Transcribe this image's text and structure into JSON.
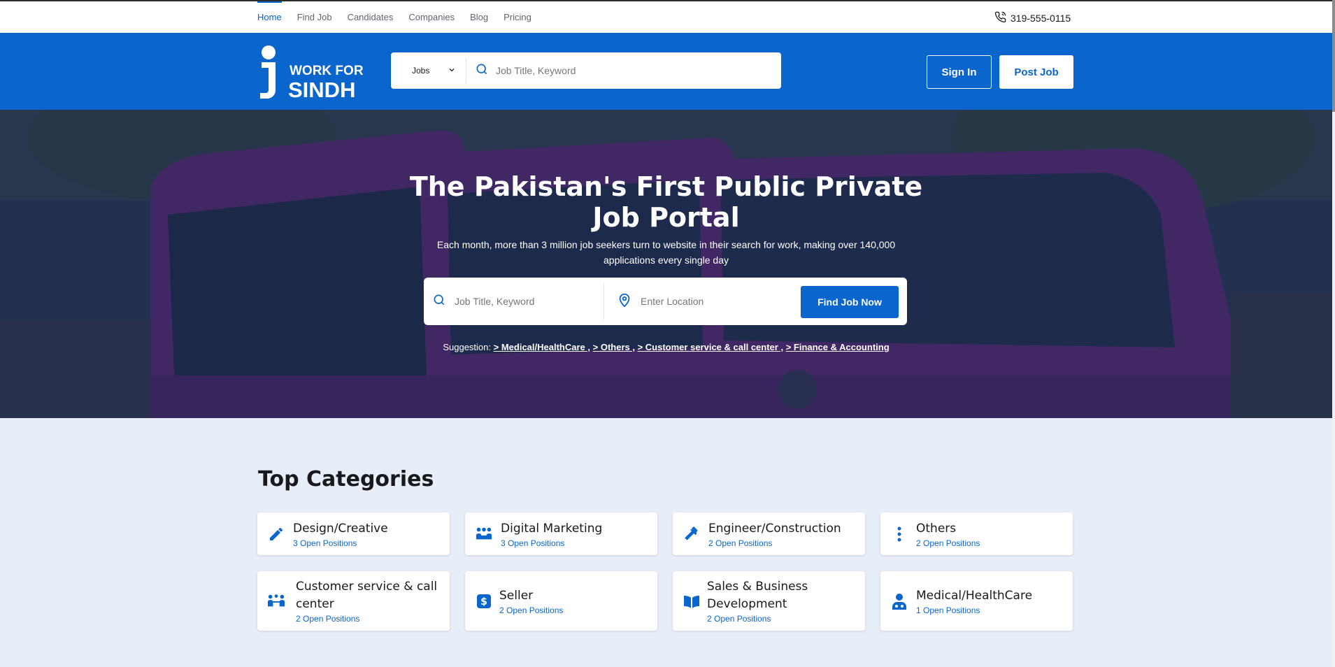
{
  "topnav": {
    "links": [
      "Home",
      "Find Job",
      "Candidates",
      "Companies",
      "Blog",
      "Pricing"
    ],
    "active_index": 0,
    "phone": "319-555-0115"
  },
  "header": {
    "logo_line1": "WORK FOR",
    "logo_line2": "SINDH",
    "search_select": "Jobs",
    "search_placeholder": "Job Title, Keyword",
    "signin_label": "Sign In",
    "postjob_label": "Post Job"
  },
  "hero": {
    "title_part1": "The ",
    "title_bold": "Pakistan's First",
    "title_part2": " Public Private",
    "title_line2": "Job Portal",
    "subtitle": "Each month, more than 3 million job seekers turn to website in their search for work, making over 140,000 applications every single day",
    "keyword_placeholder": "Job Title, Keyword",
    "location_placeholder": "Enter Location",
    "find_button": "Find Job Now",
    "suggestion_label": "Suggestion:",
    "suggestions": [
      "> Medical/HealthCare ,",
      "> Others ,",
      "> Customer service & call center ,",
      "> Finance & Accounting"
    ]
  },
  "categories": {
    "heading": "Top Categories",
    "items": [
      {
        "title": "Design/Creative",
        "positions": "3 Open Positions",
        "icon": "pencil-icon"
      },
      {
        "title": "Digital Marketing",
        "positions": "3 Open Positions",
        "icon": "people-group-icon"
      },
      {
        "title": "Engineer/Construction",
        "positions": "2 Open Positions",
        "icon": "hammer-icon"
      },
      {
        "title": "Others",
        "positions": "2 Open Positions",
        "icon": "ellipsis-vertical-icon"
      },
      {
        "title": "Customer service & call center",
        "positions": "2 Open Positions",
        "icon": "people-table-icon"
      },
      {
        "title": "Seller",
        "positions": "2 Open Positions",
        "icon": "dollar-square-icon"
      },
      {
        "title": "Sales & Business Development",
        "positions": "2 Open Positions",
        "icon": "book-open-icon"
      },
      {
        "title": "Medical/HealthCare",
        "positions": "1 Open Positions",
        "icon": "doctor-icon"
      }
    ]
  },
  "colors": {
    "primary": "#0a65cc",
    "page_bg": "#e8eef8"
  }
}
